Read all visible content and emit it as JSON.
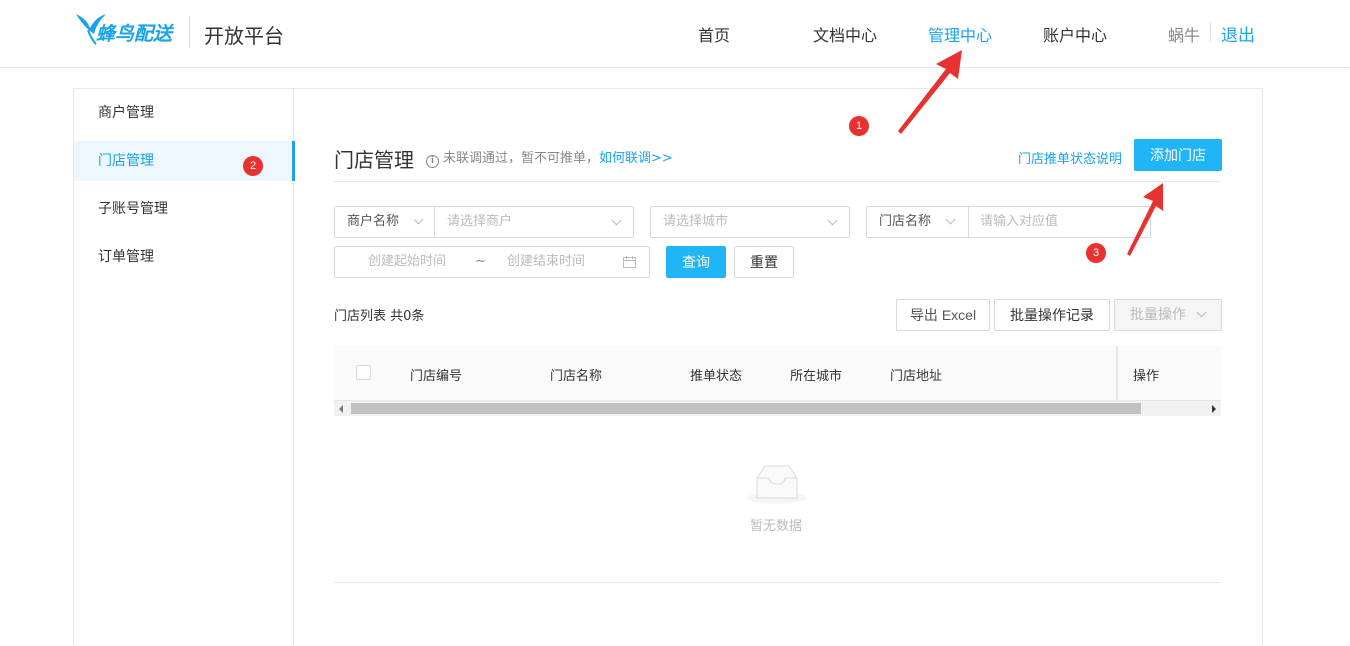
{
  "header": {
    "logo_text": "蜂鸟配送",
    "platform": "开放平台",
    "nav": [
      {
        "label": "首页"
      },
      {
        "label": "文档中心"
      },
      {
        "label": "管理中心"
      },
      {
        "label": "账户中心"
      }
    ],
    "user": "蜗牛",
    "logout": "退出"
  },
  "sidebar": {
    "items": [
      {
        "label": "商户管理"
      },
      {
        "label": "门店管理"
      },
      {
        "label": "子账号管理"
      },
      {
        "label": "订单管理"
      }
    ]
  },
  "main": {
    "title": "门店管理",
    "hint_icon": "i",
    "hint": "未联调通过，暂不可推单，",
    "hint_link": "如何联调>>",
    "status_link": "门店推单状态说明",
    "add_button": "添加门店",
    "filters": {
      "merchant_label": "商户名称",
      "merchant_placeholder": "请选择商户",
      "city_placeholder": "请选择城市",
      "store_label": "门店名称",
      "store_placeholder": "请输入对应值",
      "start_placeholder": "创建起始时间",
      "range_sep": "~",
      "end_placeholder": "创建结束时间",
      "query": "查询",
      "reset": "重置"
    },
    "list_title": "门店列表 共0条",
    "export": "导出 Excel",
    "batch_record": "批量操作记录",
    "batch_op": "批量操作",
    "columns": [
      "门店编号",
      "门店名称",
      "推单状态",
      "所在城市",
      "门店地址"
    ],
    "op_column": "操作",
    "empty": "暂无数据"
  },
  "annotations": {
    "badges": [
      "1",
      "2",
      "3"
    ],
    "color": "#e83232"
  },
  "colors": {
    "accent": "#1aa3ea",
    "primary_button": "#20b5f6"
  }
}
